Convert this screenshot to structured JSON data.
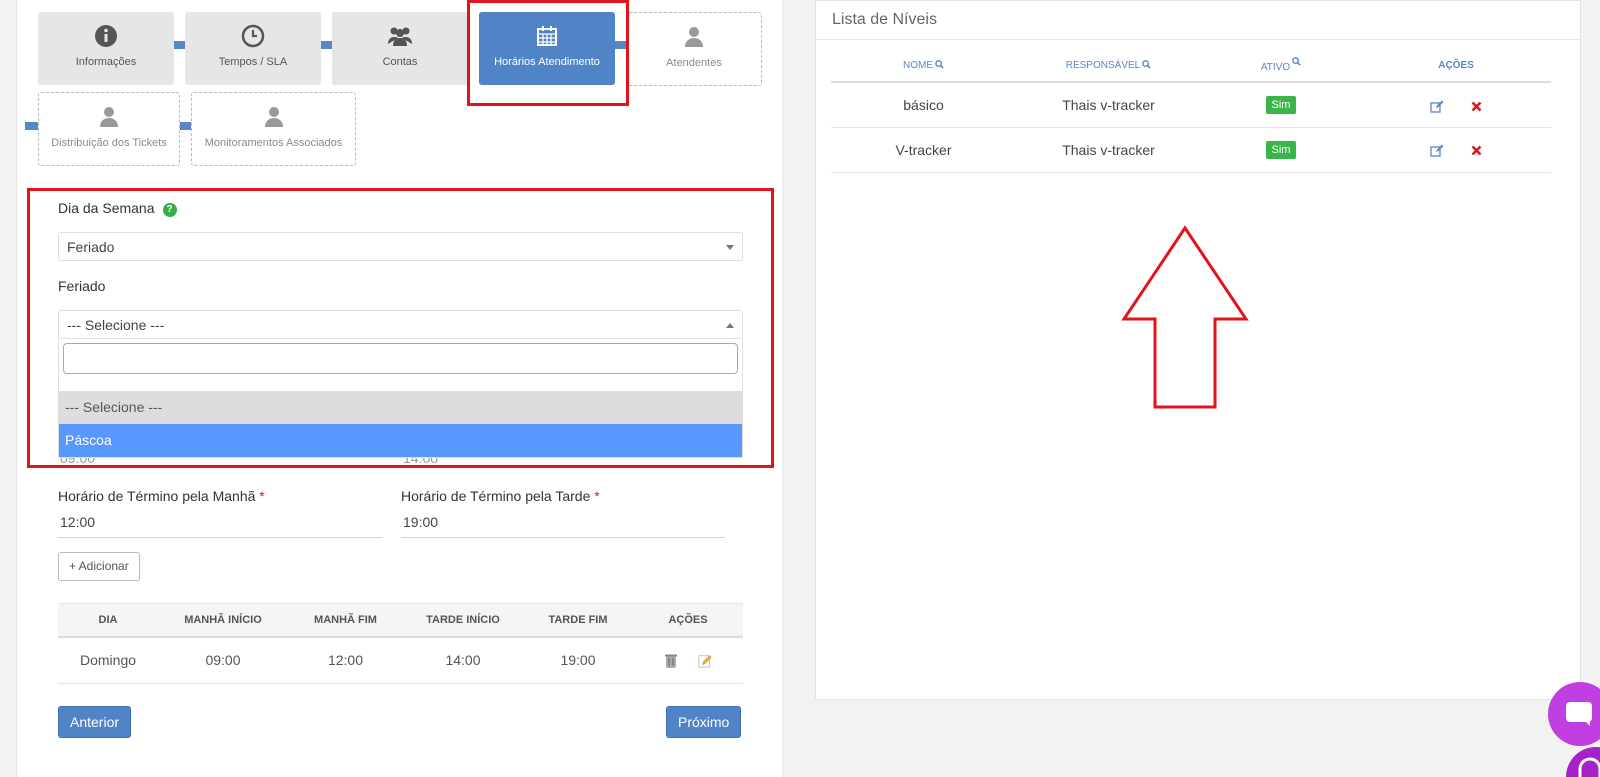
{
  "wizard": {
    "steps": [
      {
        "label": "Informações",
        "icon": "info-icon",
        "state": "done"
      },
      {
        "label": "Tempos / SLA",
        "icon": "clock-icon",
        "state": "done"
      },
      {
        "label": "Contas",
        "icon": "users-icon",
        "state": "done"
      },
      {
        "label": "Horários Atendimento",
        "icon": "calendar-icon",
        "state": "active"
      },
      {
        "label": "Atendentes",
        "icon": "user-icon",
        "state": "pending"
      },
      {
        "label": "Distribuição dos Tickets",
        "icon": "user-icon",
        "state": "pending"
      },
      {
        "label": "Monitoramentos Associados",
        "icon": "user-icon",
        "state": "pending"
      }
    ]
  },
  "form": {
    "day_label": "Dia da Semana",
    "day_help": "?",
    "day_value": "Feriado",
    "holiday_label": "Feriado",
    "holiday_value": "--- Selecione ---",
    "dropdown_options": [
      "--- Selecione ---",
      "Páscoa"
    ],
    "partial_values": [
      "09:00",
      "14:00"
    ],
    "end_morning_label": "Horário de Término pela Manhã",
    "end_morning_value": "12:00",
    "end_afternoon_label": "Horário de Término pela Tarde",
    "end_afternoon_value": "19:00",
    "required_mark": "*",
    "add_button": "+ Adicionar"
  },
  "schedule_table": {
    "headers": [
      "DIA",
      "MANHÃ INÍCIO",
      "MANHÃ FIM",
      "TARDE INÍCIO",
      "TARDE FIM",
      "AÇÕES"
    ],
    "rows": [
      [
        "Domingo",
        "09:00",
        "12:00",
        "14:00",
        "19:00"
      ]
    ]
  },
  "nav": {
    "prev": "Anterior",
    "next": "Próximo"
  },
  "levels_panel": {
    "title": "Lista de Níveis",
    "headers": [
      "NOME",
      "RESPONSÁVEL",
      "ATIVO",
      "AÇÕES"
    ],
    "rows": [
      {
        "name": "básico",
        "owner": "Thais v-tracker",
        "active": "Sim"
      },
      {
        "name": "V-tracker",
        "owner": "Thais v-tracker",
        "active": "Sim"
      }
    ]
  },
  "colors": {
    "accent": "#5184c7",
    "annotation_red": "#e3131c",
    "badge_green": "#39b54a",
    "highlight": "#5897fb",
    "chat": "#c13ee0"
  }
}
